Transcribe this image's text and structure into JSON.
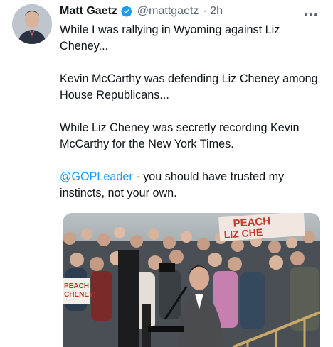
{
  "author": {
    "name": "Matt Gaetz",
    "handle": "@mattgaetz",
    "time": "· 2h",
    "verified": true
  },
  "tweet": {
    "p1": "While I was rallying in Wyoming against Liz Cheney...",
    "p2": "Kevin McCarthy was defending Liz Cheney among House Republicans...",
    "p3": "While Liz Cheney was secretly recording Kevin McCarthy for the New York Times.",
    "p4_mention": "@GOPLeader",
    "p4_rest": " - you should have trusted my instincts, not your own."
  },
  "media": {
    "sign_top_1": "PEACH",
    "sign_top_2": "LIZ CHE",
    "sign_left_1": "PEACH",
    "sign_left_2": "CHENEY!"
  },
  "colors": {
    "accent": "#1d9bf0",
    "text": "#0f1419",
    "secondary": "#536471"
  },
  "icons": [
    "verified-badge-icon",
    "more-options-icon"
  ]
}
